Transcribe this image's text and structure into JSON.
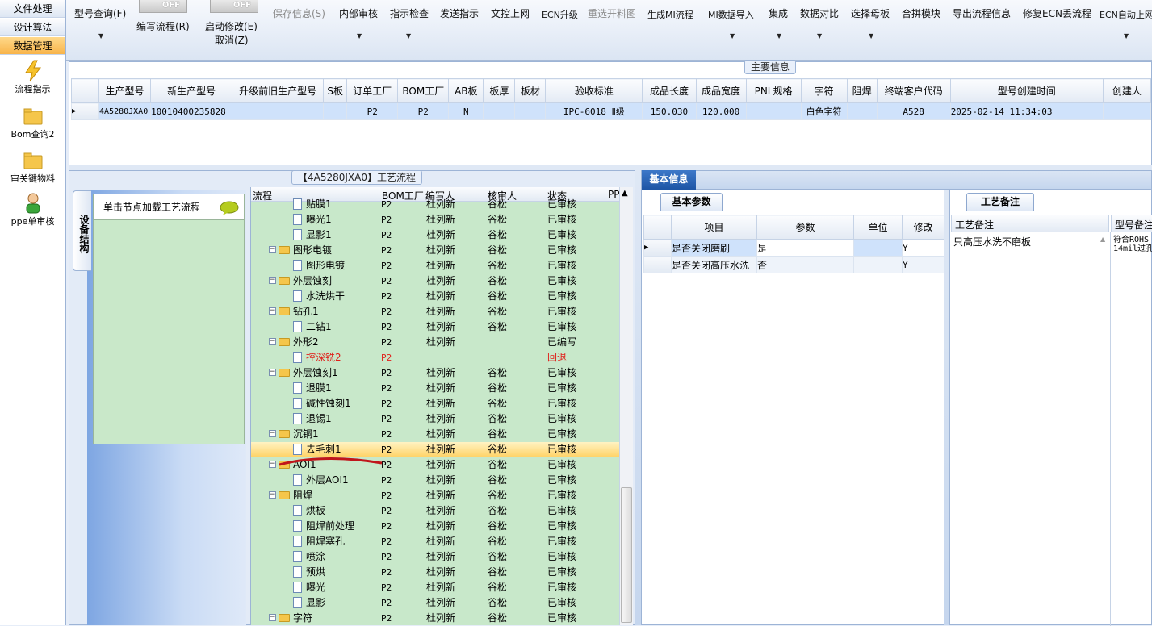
{
  "nav": {
    "headers": [
      "文件处理",
      "设计算法",
      "数据管理"
    ],
    "items": [
      "流程指示",
      "Bom查询2",
      "审关键物料",
      "ppe单审核"
    ]
  },
  "toolbar": {
    "model_query": "型号查询(F)",
    "edit_flow": "编写流程(R)",
    "enable_modify": "启动修改(E)",
    "cancel": "取消(Z)",
    "toggle_off": "OFF",
    "buttons": [
      "保存信息(S)",
      "内部审核",
      "指示检查",
      "发送指示",
      "文控上网",
      "ECN升级",
      "重选开料图",
      "生成MI流程",
      "MI数据导入",
      "集成",
      "数据对比",
      "选择母板",
      "合拼模块",
      "导出流程信息",
      "修复ECN丢流程",
      "ECN自动上网"
    ]
  },
  "main_info": {
    "title": "主要信息",
    "columns": [
      "生产型号",
      "新生产型号",
      "升级前旧生产型号",
      "S板",
      "订单工厂",
      "BOM工厂",
      "AB板",
      "板厚",
      "板材",
      "验收标准",
      "成品长度",
      "成品宽度",
      "PNL规格",
      "字符",
      "阻焊",
      "终端客户代码",
      "型号创建时间",
      "创建人"
    ],
    "row": [
      "4A5280JXA0",
      "10010400235828",
      "",
      "",
      "P2",
      "P2",
      "N",
      "",
      "",
      "IPC-6018 Ⅱ级",
      "150.030",
      "120.000",
      "",
      "白色字符",
      "",
      "A528",
      "2025-02-14 11:34:03",
      ""
    ]
  },
  "process": {
    "title": "【4A5280JXA0】工艺流程",
    "side_tab": "设备结构",
    "click_hint": "单击节点加载工艺流程",
    "columns": [
      "流程",
      "BOM工厂",
      "编写人",
      "核审人",
      "状态",
      "PP("
    ],
    "rows": [
      {
        "name": "贴膜1",
        "bom": "P2",
        "writer": "杜列新",
        "reviewer": "谷松",
        "status": "已审核",
        "lvl": 2
      },
      {
        "name": "曝光1",
        "bom": "P2",
        "writer": "杜列新",
        "reviewer": "谷松",
        "status": "已审核",
        "lvl": 2
      },
      {
        "name": "显影1",
        "bom": "P2",
        "writer": "杜列新",
        "reviewer": "谷松",
        "status": "已审核",
        "lvl": 2
      },
      {
        "name": "图形电镀",
        "bom": "P2",
        "writer": "杜列新",
        "reviewer": "谷松",
        "status": "已审核",
        "lvl": 1
      },
      {
        "name": "图形电镀",
        "bom": "P2",
        "writer": "杜列新",
        "reviewer": "谷松",
        "status": "已审核",
        "lvl": 2
      },
      {
        "name": "外层蚀刻",
        "bom": "P2",
        "writer": "杜列新",
        "reviewer": "谷松",
        "status": "已审核",
        "lvl": 1
      },
      {
        "name": "水洗烘干",
        "bom": "P2",
        "writer": "杜列新",
        "reviewer": "谷松",
        "status": "已审核",
        "lvl": 2
      },
      {
        "name": "钻孔1",
        "bom": "P2",
        "writer": "杜列新",
        "reviewer": "谷松",
        "status": "已审核",
        "lvl": 1
      },
      {
        "name": "二钻1",
        "bom": "P2",
        "writer": "杜列新",
        "reviewer": "谷松",
        "status": "已审核",
        "lvl": 2
      },
      {
        "name": "外形2",
        "bom": "P2",
        "writer": "杜列新",
        "reviewer": "",
        "status": "已编写",
        "lvl": 1
      },
      {
        "name": "控深铣2",
        "bom": "P2",
        "writer": "",
        "reviewer": "",
        "status": "回退",
        "lvl": 2,
        "red": true
      },
      {
        "name": "外层蚀刻1",
        "bom": "P2",
        "writer": "杜列新",
        "reviewer": "谷松",
        "status": "已审核",
        "lvl": 1
      },
      {
        "name": "退膜1",
        "bom": "P2",
        "writer": "杜列新",
        "reviewer": "谷松",
        "status": "已审核",
        "lvl": 2
      },
      {
        "name": "碱性蚀刻1",
        "bom": "P2",
        "writer": "杜列新",
        "reviewer": "谷松",
        "status": "已审核",
        "lvl": 2
      },
      {
        "name": "退锡1",
        "bom": "P2",
        "writer": "杜列新",
        "reviewer": "谷松",
        "status": "已审核",
        "lvl": 2
      },
      {
        "name": "沉铜1",
        "bom": "P2",
        "writer": "杜列新",
        "reviewer": "谷松",
        "status": "已审核",
        "lvl": 1
      },
      {
        "name": "去毛刺1",
        "bom": "P2",
        "writer": "杜列新",
        "reviewer": "谷松",
        "status": "已审核",
        "lvl": 2,
        "hl": true
      },
      {
        "name": "AOI1",
        "bom": "P2",
        "writer": "杜列新",
        "reviewer": "谷松",
        "status": "已审核",
        "lvl": 1
      },
      {
        "name": "外层AOI1",
        "bom": "P2",
        "writer": "杜列新",
        "reviewer": "谷松",
        "status": "已审核",
        "lvl": 2
      },
      {
        "name": "阻焊",
        "bom": "P2",
        "writer": "杜列新",
        "reviewer": "谷松",
        "status": "已审核",
        "lvl": 1
      },
      {
        "name": "烘板",
        "bom": "P2",
        "writer": "杜列新",
        "reviewer": "谷松",
        "status": "已审核",
        "lvl": 2
      },
      {
        "name": "阻焊前处理",
        "bom": "P2",
        "writer": "杜列新",
        "reviewer": "谷松",
        "status": "已审核",
        "lvl": 2
      },
      {
        "name": "阻焊塞孔",
        "bom": "P2",
        "writer": "杜列新",
        "reviewer": "谷松",
        "status": "已审核",
        "lvl": 2
      },
      {
        "name": "喷涂",
        "bom": "P2",
        "writer": "杜列新",
        "reviewer": "谷松",
        "status": "已审核",
        "lvl": 2
      },
      {
        "name": "预烘",
        "bom": "P2",
        "writer": "杜列新",
        "reviewer": "谷松",
        "status": "已审核",
        "lvl": 2
      },
      {
        "name": "曝光",
        "bom": "P2",
        "writer": "杜列新",
        "reviewer": "谷松",
        "status": "已审核",
        "lvl": 2
      },
      {
        "name": "显影",
        "bom": "P2",
        "writer": "杜列新",
        "reviewer": "谷松",
        "status": "已审核",
        "lvl": 2
      },
      {
        "name": "字符",
        "bom": "P2",
        "writer": "杜列新",
        "reviewer": "谷松",
        "status": "已审核",
        "lvl": 1
      }
    ]
  },
  "basic_info": {
    "tab": "基本信息",
    "param_tab": "基本参数",
    "columns": [
      "项目",
      "参数",
      "单位",
      "修改"
    ],
    "rows": [
      {
        "item": "是否关闭磨刷",
        "value": "是",
        "unit": "",
        "mod": "Y"
      },
      {
        "item": "是否关闭高压水洗",
        "value": "否",
        "unit": "",
        "mod": "Y"
      }
    ]
  },
  "remarks": {
    "tab": "工艺备注",
    "col1": "工艺备注",
    "col2": "型号备注",
    "text1": "只高压水洗不磨板",
    "text2a": "符合ROHS",
    "text2b": "14mil过孔"
  },
  "colors": {
    "accent": "#1d55a5",
    "tree_bg": "#c8e8ca",
    "highlight": "#ffd264",
    "rollback": "#e0201b"
  }
}
